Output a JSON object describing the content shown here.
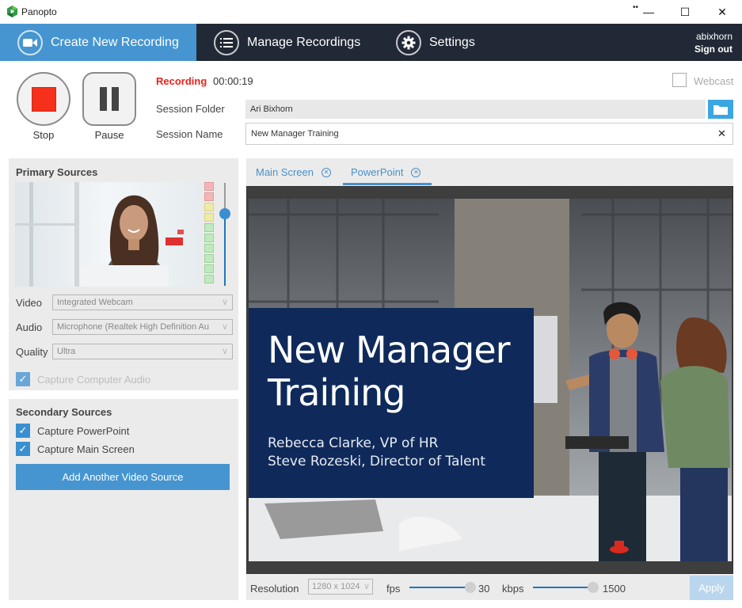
{
  "window": {
    "app_title": "Panopto",
    "extra_glyph": "••",
    "minimize_glyph": "—",
    "maximize_glyph": "☐",
    "close_glyph": "✕"
  },
  "nav": {
    "tabs": [
      {
        "label": "Create New Recording",
        "icon": "video-camera-icon",
        "active": true
      },
      {
        "label": "Manage Recordings",
        "icon": "list-icon",
        "active": false
      },
      {
        "label": "Settings",
        "icon": "gear-icon",
        "active": false
      }
    ],
    "username": "abixhorn",
    "sign_out": "Sign out"
  },
  "controls": {
    "stop_label": "Stop",
    "pause_label": "Pause",
    "recording_status": "Recording",
    "elapsed_time": "00:00:19",
    "webcast_label": "Webcast",
    "webcast_checked": false
  },
  "session": {
    "folder_label": "Session Folder",
    "folder_value": "Ari Bixhorn",
    "name_label": "Session Name",
    "name_value": "New Manager Training",
    "clear_glyph": "✕"
  },
  "primary_sources": {
    "title": "Primary Sources",
    "audio_meter_levels": [
      "red",
      "red",
      "yellow",
      "yellow",
      "green",
      "green",
      "green",
      "green",
      "green",
      "green"
    ],
    "volume_percent": 70,
    "video_label": "Video",
    "video_value": "Integrated Webcam",
    "audio_label": "Audio",
    "audio_value": "Microphone (Realtek High Definition Au",
    "quality_label": "Quality",
    "quality_value": "Ultra",
    "capture_audio_label": "Capture Computer Audio",
    "capture_audio_checked": true
  },
  "secondary_sources": {
    "title": "Secondary Sources",
    "items": [
      {
        "label": "Capture PowerPoint",
        "checked": true
      },
      {
        "label": "Capture Main Screen",
        "checked": true
      }
    ],
    "add_button": "Add Another Video Source"
  },
  "preview": {
    "tabs": [
      {
        "label": "Main Screen",
        "active": false
      },
      {
        "label": "PowerPoint",
        "active": true
      }
    ],
    "slide_title_line1": "New Manager",
    "slide_title_line2": "Training",
    "slide_sub_line1": "Rebecca Clarke, VP of HR",
    "slide_sub_line2": "Steve Rozeski, Director of Talent"
  },
  "output_settings": {
    "resolution_label": "Resolution",
    "resolution_value": "1280 x 1024",
    "fps_label": "fps",
    "fps_value": "30",
    "kbps_label": "kbps",
    "kbps_value": "1500",
    "apply_label": "Apply"
  },
  "colors": {
    "accent": "#4695d0",
    "nav_bg": "#212936",
    "record_red": "#f5301b",
    "slide_blue": "#0f2a5a"
  }
}
